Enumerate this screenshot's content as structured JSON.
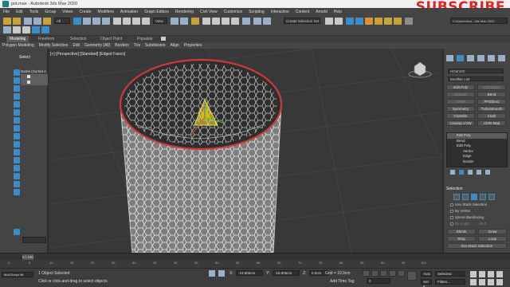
{
  "window": {
    "title": "pot.max - Autodesk 3ds Max 2020",
    "overlay_text": "SUBSCRIBE"
  },
  "menu": [
    "File",
    "Edit",
    "Tools",
    "Group",
    "Views",
    "Create",
    "Modifiers",
    "Animation",
    "Graph Editors",
    "Rendering",
    "Civil View",
    "Customize",
    "Scripting",
    "Interactive",
    "Content",
    "Arnold",
    "Help"
  ],
  "toolbar": {
    "selection_filter": "All",
    "view_dropdown": "View",
    "selection_set": "Create Selection Set",
    "workspace": "C:\\Users\\Hea...3ds Max 2020"
  },
  "ribbon": {
    "tabs": [
      "Modeling",
      "Freeform",
      "Selection",
      "Object Paint",
      "Populate"
    ],
    "active_tab": "Modeling",
    "panels": [
      "Polygon Modeling",
      "Modify Selection",
      "Edit",
      "Geometry (All)",
      "Borders",
      "Tris",
      "Subdivision",
      "Align",
      "Properties"
    ]
  },
  "scene_explorer": {
    "header": "Select",
    "column": "Name (Sorted A",
    "items": [
      "",
      ""
    ]
  },
  "viewport": {
    "label": "[+] [Perspective] [Standard] [Edged Faces]"
  },
  "command_panel": {
    "object_name": "HGaro03",
    "modifier_list": "Modifier List",
    "buttons": [
      {
        "label": "Edit Poly",
        "dim": false
      },
      {
        "label": "Edit Spline",
        "dim": true
      },
      {
        "label": "Extrude",
        "dim": true
      },
      {
        "label": "Bend",
        "dim": false
      },
      {
        "label": "Bevel",
        "dim": true
      },
      {
        "label": "FFD(box)",
        "dim": false
      },
      {
        "label": "Symmetry",
        "dim": false
      },
      {
        "label": "TurboSmooth",
        "dim": false
      },
      {
        "label": "Chamfer",
        "dim": false
      },
      {
        "label": "Cloth",
        "dim": false
      },
      {
        "label": "Unwrap UVW",
        "dim": false
      },
      {
        "label": "UVW Map",
        "dim": false
      }
    ],
    "stack": [
      {
        "label": "Edit Poly",
        "selected": true
      },
      {
        "label": "Bend",
        "selected": false
      },
      {
        "label": "Edit Poly",
        "selected": false
      },
      {
        "label": "Vertex",
        "selected": false
      },
      {
        "label": "Edge",
        "selected": false
      },
      {
        "label": "Border",
        "selected": false
      }
    ],
    "selection_title": "Selection",
    "options": [
      "Use Stack Selection",
      "By Vertex",
      "Ignore Backfacing",
      "By Angle:"
    ],
    "by_angle_value": "45.0",
    "shrink": "Shrink",
    "grow": "Grow",
    "ring": "Ring",
    "loop": "Loop",
    "get_stack": "Get Stack Selection"
  },
  "timeline": {
    "current": "0 / 100",
    "ticks": [
      "0",
      "5",
      "10",
      "15",
      "20",
      "25",
      "30",
      "35",
      "40",
      "45",
      "50",
      "55",
      "60",
      "65",
      "70",
      "75",
      "80",
      "85",
      "90",
      "95",
      "100"
    ]
  },
  "status": {
    "maxscript": "MAXScript Mi:",
    "line1": "1 Object Selected",
    "line2": "Click or click-and-drag to select objects",
    "x_label": "X:",
    "x_value": "-19.806cm",
    "y_label": "Y:",
    "y_value": "-16.806cm",
    "z_label": "Z:",
    "z_value": "0.0cm",
    "grid": "Grid = 10.0cm",
    "add_time_tag": "Add Time Tag",
    "auto": "Auto",
    "set_key": "Set K.",
    "selected": "Selected",
    "filters": "Filters...",
    "frame": "0"
  },
  "colors": {
    "accent_blue": "#3c8cc8",
    "selection_yellow": "#f2e63c",
    "overlay_red": "#e3231f"
  }
}
